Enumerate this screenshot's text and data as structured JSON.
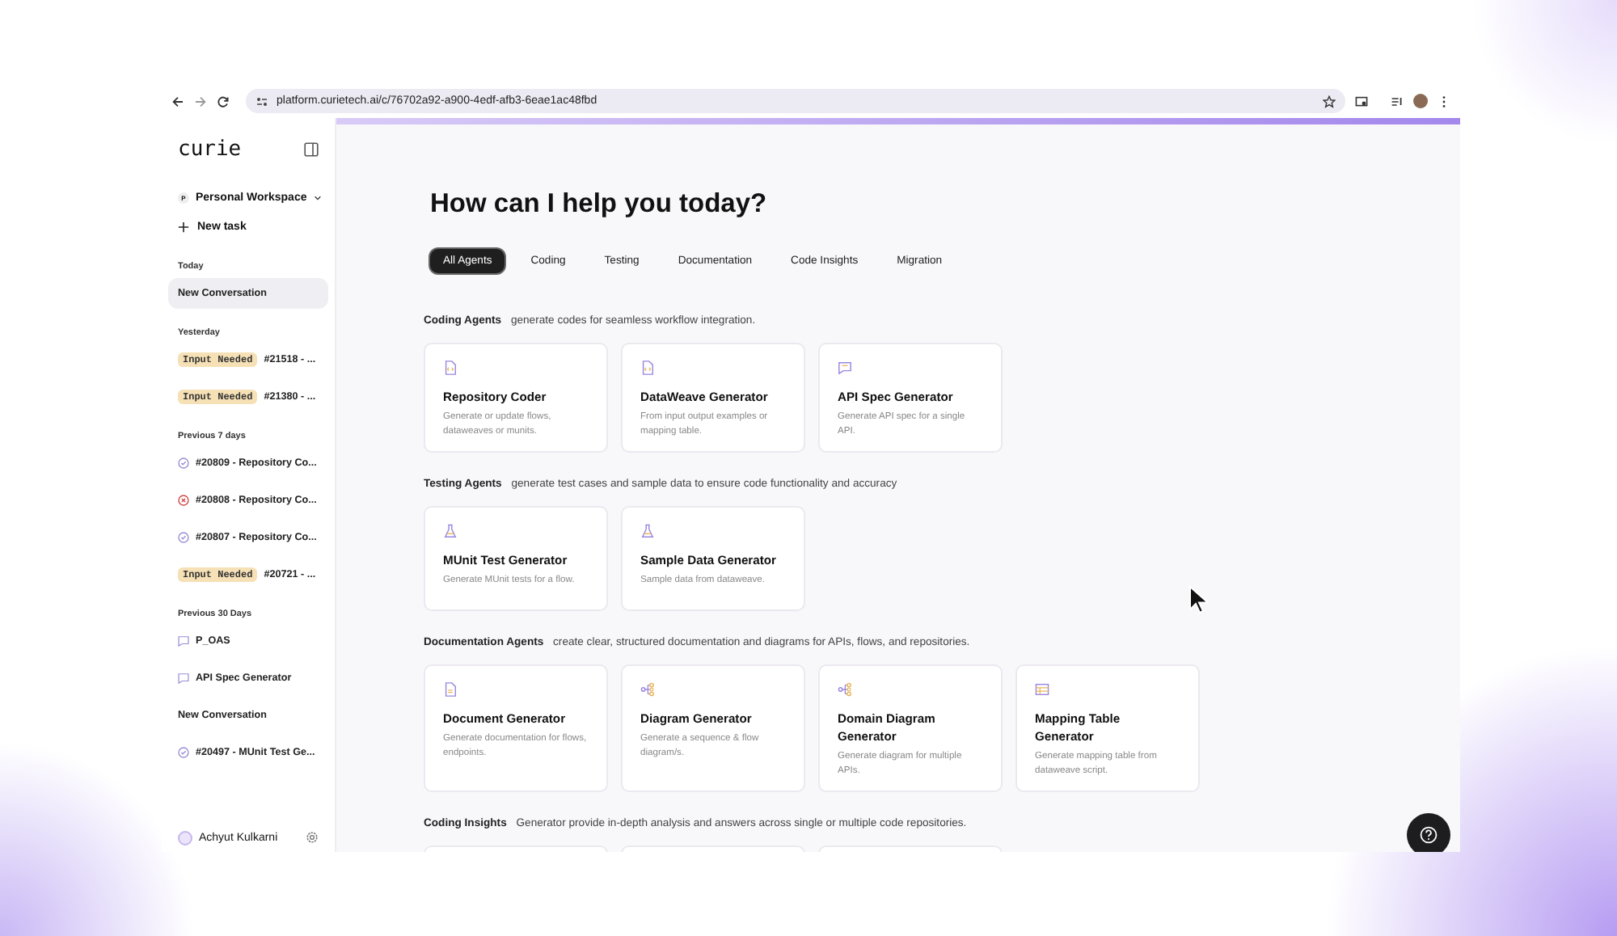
{
  "browser": {
    "url": "platform.curietech.ai/c/76702a92-a900-4edf-afb3-6eae1ac48fbd"
  },
  "sidebar": {
    "logo": "curie",
    "workspace": {
      "initial": "P",
      "name": "Personal Workspace"
    },
    "new_task": "New task",
    "groups": [
      {
        "heading": "Today",
        "items": [
          {
            "kind": "plain",
            "label": "New Conversation",
            "selected": true
          }
        ]
      },
      {
        "heading": "Yesterday",
        "items": [
          {
            "kind": "input_needed",
            "badge": "Input Needed",
            "label": "#21518 - ...",
            "selected": false
          },
          {
            "kind": "input_needed",
            "badge": "Input Needed",
            "label": "#21380 - ...",
            "selected": false
          }
        ]
      },
      {
        "heading": "Previous 7 days",
        "items": [
          {
            "kind": "done",
            "label": "#20809 - Repository Co...",
            "selected": false
          },
          {
            "kind": "failed",
            "label": "#20808 - Repository Co...",
            "selected": false
          },
          {
            "kind": "done",
            "label": "#20807 - Repository Co...",
            "selected": false
          },
          {
            "kind": "input_needed",
            "badge": "Input Needed",
            "label": "#20721 - ...",
            "selected": false
          }
        ]
      },
      {
        "heading": "Previous 30 Days",
        "items": [
          {
            "kind": "chat",
            "label": "P_OAS",
            "selected": false
          },
          {
            "kind": "chat",
            "label": "API Spec Generator",
            "selected": false
          },
          {
            "kind": "plain",
            "label": "New Conversation",
            "selected": false
          },
          {
            "kind": "done",
            "label": "#20497 - MUnit Test Ge...",
            "selected": false
          }
        ]
      }
    ],
    "user": {
      "name": "Achyut Kulkarni"
    }
  },
  "main": {
    "title": "How can I help you today?",
    "tabs": [
      {
        "label": "All Agents",
        "selected": true
      },
      {
        "label": "Coding",
        "selected": false
      },
      {
        "label": "Testing",
        "selected": false
      },
      {
        "label": "Documentation",
        "selected": false
      },
      {
        "label": "Code Insights",
        "selected": false
      },
      {
        "label": "Migration",
        "selected": false
      }
    ],
    "sections": [
      {
        "heading": "Coding Agents",
        "description": "generate codes for seamless workflow integration.",
        "cards": [
          {
            "kind": "code",
            "title": "Repository Coder",
            "description": "Generate or update flows, dataweaves or munits."
          },
          {
            "kind": "code",
            "title": "DataWeave Generator",
            "description": "From input output examples or mapping table."
          },
          {
            "kind": "chat",
            "title": "API Spec Generator",
            "description": "Generate API spec for a single API."
          }
        ]
      },
      {
        "heading": "Testing Agents",
        "description": "generate test cases and sample data to ensure code functionality and accuracy",
        "cards": [
          {
            "kind": "flask",
            "title": "MUnit Test Generator",
            "description": "Generate MUnit tests for a flow."
          },
          {
            "kind": "flask",
            "title": "Sample Data Generator",
            "description": "Sample data from dataweave."
          }
        ]
      },
      {
        "heading": "Documentation Agents",
        "description": "create clear, structured documentation and diagrams for APIs, flows, and repositories.",
        "cards": [
          {
            "kind": "document",
            "title": "Document Generator",
            "description": "Generate documentation for flows, endpoints."
          },
          {
            "kind": "diagram",
            "title": "Diagram Generator",
            "description": "Generate a sequence & flow diagram/s."
          },
          {
            "kind": "diagram",
            "title": "Domain Diagram Generator",
            "description": "Generate diagram for multiple APIs."
          },
          {
            "kind": "table",
            "title": "Mapping Table Generator",
            "description": "Generate mapping table from dataweave script."
          }
        ]
      },
      {
        "heading": "Coding Insights",
        "description": "Generator provide in-depth analysis and answers across single or multiple code repositories.",
        "cards": [
          {
            "kind": "blank"
          },
          {
            "kind": "blank"
          },
          {
            "kind": "blank"
          }
        ]
      }
    ]
  }
}
